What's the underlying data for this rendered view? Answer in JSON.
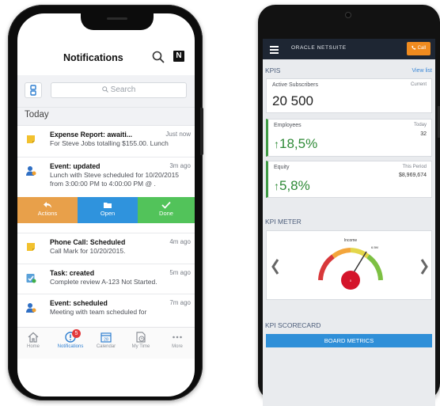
{
  "ios": {
    "header_title": "Notifications",
    "logo_letter": "N",
    "search_placeholder": "Search",
    "section_title": "Today",
    "notifications": [
      {
        "title": "Expense Report: awaiti...",
        "time": "Just now",
        "body": "For Steve Jobs totalling $155.00. Lunch",
        "icon": "note-icon"
      },
      {
        "title": "Event: updated",
        "time": "3m ago",
        "body": "Lunch with Steve scheduled for 10/20/2015 from 3:00:00 PM to 4:00:00 PM @ .",
        "icon": "person-icon"
      },
      {
        "title": "Phone Call: Scheduled",
        "time": "4m ago",
        "body": "Call Mark for 10/20/2015.",
        "icon": "note-icon"
      },
      {
        "title": "Task: created",
        "time": "5m ago",
        "body": "Complete review A-123 Not Started.",
        "icon": "task-icon"
      },
      {
        "title": "Event: scheduled",
        "time": "7m ago",
        "body": "Meeting with team scheduled for",
        "icon": "person-icon"
      }
    ],
    "actions": {
      "actions_label": "Actions",
      "open_label": "Open",
      "done_label": "Done"
    },
    "action_colors": {
      "actions": "#e8a04a",
      "open": "#2f93dd",
      "done": "#52c35a"
    },
    "tabs": [
      {
        "label": "Home",
        "icon": "home-icon"
      },
      {
        "label": "Notifications",
        "icon": "alert-icon",
        "badge": "5"
      },
      {
        "label": "Calendar",
        "icon": "calendar-icon",
        "day": "28"
      },
      {
        "label": "My Time",
        "icon": "timesheet-icon"
      },
      {
        "label": "More",
        "icon": "more-icon"
      }
    ]
  },
  "android": {
    "brand": "ORACLE NETSUITE",
    "call_label": "Call",
    "kpis_title": "KPIS",
    "view_list": "View list",
    "kpi_cards": [
      {
        "label": "Active Subscribers",
        "right": "Current",
        "value": "20 500"
      },
      {
        "label": "Employees",
        "right": "Today",
        "value": "18,5%",
        "sub": "32",
        "trend": "up"
      },
      {
        "label": "Equity",
        "right": "This Period",
        "value": "5,8%",
        "sub": "$8,969,674",
        "trend": "up"
      }
    ],
    "kpi_meter_title": "KPI METER",
    "meter": {
      "label": "Income",
      "max_label": "6.5M",
      "value_label": "0"
    },
    "kpi_scorecard_title": "KPI SCORECARD",
    "scorecard_button": "BOARD METRICS",
    "colors": {
      "accent": "#2f8fd8",
      "call": "#f08b1f",
      "positive": "#2e8a36",
      "header": "#1e2633"
    }
  }
}
